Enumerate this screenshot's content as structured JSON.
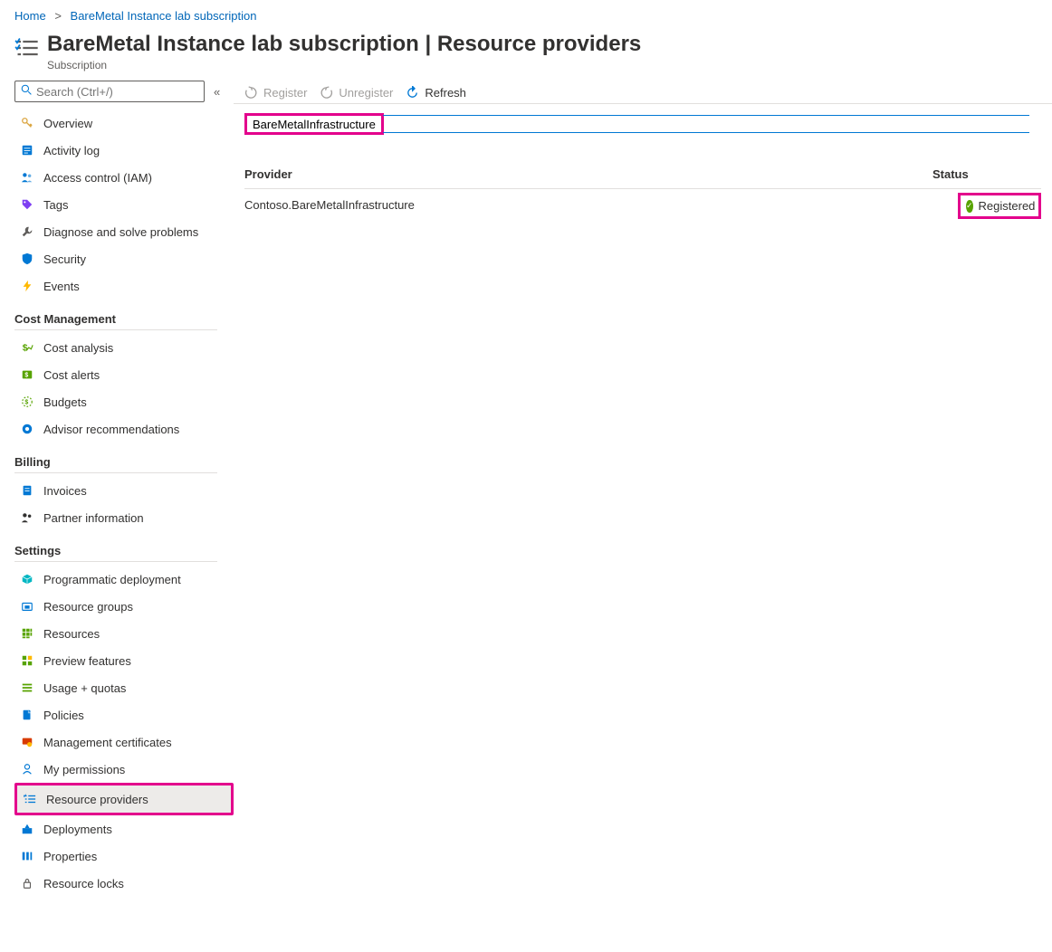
{
  "breadcrumb": {
    "home": "Home",
    "current": "BareMetal Instance lab subscription"
  },
  "header": {
    "title": "BareMetal Instance lab subscription | Resource providers",
    "subtitle": "Subscription"
  },
  "sidebar": {
    "search_placeholder": "Search (Ctrl+/)",
    "top_items": [
      {
        "label": "Overview",
        "icon": "key"
      },
      {
        "label": "Activity log",
        "icon": "log"
      },
      {
        "label": "Access control (IAM)",
        "icon": "people"
      },
      {
        "label": "Tags",
        "icon": "tag"
      },
      {
        "label": "Diagnose and solve problems",
        "icon": "wrench"
      },
      {
        "label": "Security",
        "icon": "shield"
      },
      {
        "label": "Events",
        "icon": "bolt"
      }
    ],
    "sections": [
      {
        "title": "Cost Management",
        "items": [
          {
            "label": "Cost analysis",
            "icon": "cost"
          },
          {
            "label": "Cost alerts",
            "icon": "alert-cost"
          },
          {
            "label": "Budgets",
            "icon": "budget"
          },
          {
            "label": "Advisor recommendations",
            "icon": "advisor"
          }
        ]
      },
      {
        "title": "Billing",
        "items": [
          {
            "label": "Invoices",
            "icon": "invoice"
          },
          {
            "label": "Partner information",
            "icon": "partner"
          }
        ]
      },
      {
        "title": "Settings",
        "items": [
          {
            "label": "Programmatic deployment",
            "icon": "box"
          },
          {
            "label": "Resource groups",
            "icon": "rg"
          },
          {
            "label": "Resources",
            "icon": "grid"
          },
          {
            "label": "Preview features",
            "icon": "preview"
          },
          {
            "label": "Usage + quotas",
            "icon": "bars"
          },
          {
            "label": "Policies",
            "icon": "policy"
          },
          {
            "label": "Management certificates",
            "icon": "cert"
          },
          {
            "label": "My permissions",
            "icon": "person"
          },
          {
            "label": "Resource providers",
            "icon": "providers",
            "selected": true,
            "highlight": true
          },
          {
            "label": "Deployments",
            "icon": "deploy"
          },
          {
            "label": "Properties",
            "icon": "props"
          },
          {
            "label": "Resource locks",
            "icon": "lock"
          }
        ]
      }
    ]
  },
  "toolbar": {
    "register": "Register",
    "unregister": "Unregister",
    "refresh": "Refresh"
  },
  "filter": {
    "value": "BareMetalInfrastructure"
  },
  "table": {
    "headers": {
      "provider": "Provider",
      "status": "Status"
    },
    "rows": [
      {
        "provider": "Contoso.BareMetalInfrastructure",
        "status": "Registered"
      }
    ]
  },
  "icon_colors": {
    "key": "#dba540",
    "log": "#0078d4",
    "people": "#0078d4",
    "tag": "#7e3ff2",
    "wrench": "#605e5c",
    "shield": "#0078d4",
    "bolt": "#ffb900",
    "cost": "#57a300",
    "alert-cost": "#57a300",
    "budget": "#57a300",
    "advisor": "#0078d4",
    "invoice": "#0078d4",
    "partner": "#323130",
    "box": "#00b7c3",
    "rg": "#0078d4",
    "grid": "#57a300",
    "preview": "#57a300",
    "bars": "#57a300",
    "policy": "#0078d4",
    "cert": "#d83b01",
    "person": "#0078d4",
    "providers": "#0078d4",
    "deploy": "#0078d4",
    "props": "#0078d4",
    "lock": "#605e5c"
  }
}
